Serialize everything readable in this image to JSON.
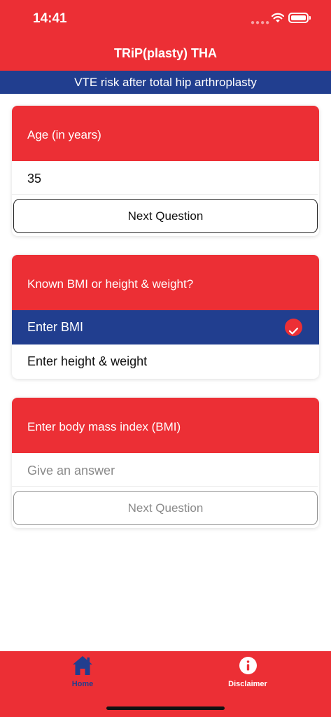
{
  "status_bar": {
    "time": "14:41"
  },
  "header": {
    "title": "TRiP(plasty) THA",
    "subtitle": "VTE risk after total hip arthroplasty"
  },
  "questions": [
    {
      "label": "Age (in years)",
      "value": "35",
      "button": "Next Question"
    },
    {
      "label": "Known BMI or height & weight?",
      "options": [
        {
          "label": "Enter BMI",
          "selected": true
        },
        {
          "label": "Enter height & weight",
          "selected": false
        }
      ]
    },
    {
      "label": "Enter body mass index (BMI)",
      "placeholder": "Give an answer",
      "button": "Next Question"
    }
  ],
  "tabbar": {
    "items": [
      {
        "label": "Home",
        "icon": "home-icon",
        "active": true
      },
      {
        "label": "Disclaimer",
        "icon": "info-icon",
        "active": false
      }
    ]
  },
  "colors": {
    "brand_red": "#ec2f35",
    "brand_blue": "#213e8f",
    "active_tab": "#213e8f"
  }
}
